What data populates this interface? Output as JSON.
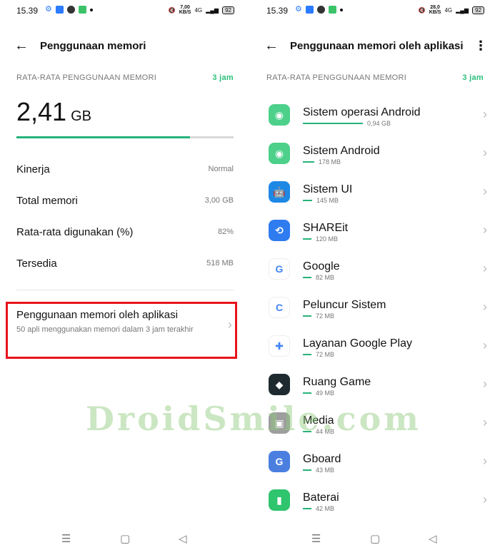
{
  "status": {
    "time": "15.39",
    "left_speed_value": "7,00",
    "left_speed_unit": "KB/S",
    "right_speed_value": "28,0",
    "right_speed_unit": "KB/S",
    "network": "4G",
    "battery": "92"
  },
  "left": {
    "title": "Penggunaan memori",
    "section_label": "RATA-RATA PENGGUNAAN MEMORI",
    "period": "3 jam",
    "usage_value": "2,41",
    "usage_unit": "GB",
    "usage_fraction": 0.8,
    "rows": [
      {
        "label": "Kinerja",
        "value": "Normal"
      },
      {
        "label": "Total memori",
        "value": "3,00 GB"
      },
      {
        "label": "Rata-rata digunakan (%)",
        "value": "82%"
      },
      {
        "label": "Tersedia",
        "value": "518 MB"
      }
    ],
    "app_usage_title": "Penggunaan memori oleh aplikasi",
    "app_usage_subtitle": "50 apli menggunakan memori dalam 3 jam terakhir"
  },
  "right": {
    "title": "Penggunaan memori oleh aplikasi",
    "section_label": "RATA-RATA PENGGUNAAN MEMORI",
    "period": "3 jam",
    "apps": [
      {
        "name": "Sistem operasi Android",
        "mem": "0,94 GB",
        "mb": 962,
        "icon": "android-os-icon",
        "color": "#4cd08a"
      },
      {
        "name": "Sistem Android",
        "mem": "178 MB",
        "mb": 178,
        "icon": "android-system-icon",
        "color": "#4cd08a"
      },
      {
        "name": "Sistem UI",
        "mem": "145 MB",
        "mb": 145,
        "icon": "android-robot-icon",
        "color": "#1e88e5"
      },
      {
        "name": "SHAREit",
        "mem": "120 MB",
        "mb": 120,
        "icon": "shareit-icon",
        "color": "#2f7bf0"
      },
      {
        "name": "Google",
        "mem": "82 MB",
        "mb": 82,
        "icon": "google-icon",
        "color": "#ffffff"
      },
      {
        "name": "Peluncur Sistem",
        "mem": "72 MB",
        "mb": 72,
        "icon": "coloros-icon",
        "color": "#ffffff"
      },
      {
        "name": "Layanan Google Play",
        "mem": "72 MB",
        "mb": 72,
        "icon": "google-play-services-icon",
        "color": "#ffffff"
      },
      {
        "name": "Ruang Game",
        "mem": "49 MB",
        "mb": 49,
        "icon": "game-space-icon",
        "color": "#1f2a30"
      },
      {
        "name": "Media",
        "mem": "44 MB",
        "mb": 44,
        "icon": "media-icon",
        "color": "#9e9e9e"
      },
      {
        "name": "Gboard",
        "mem": "43 MB",
        "mb": 43,
        "icon": "gboard-icon",
        "color": "#4a7fe0"
      },
      {
        "name": "Baterai",
        "mem": "42 MB",
        "mb": 42,
        "icon": "battery-icon",
        "color": "#2fc46e"
      }
    ]
  },
  "watermark": "DroidSmile.com"
}
